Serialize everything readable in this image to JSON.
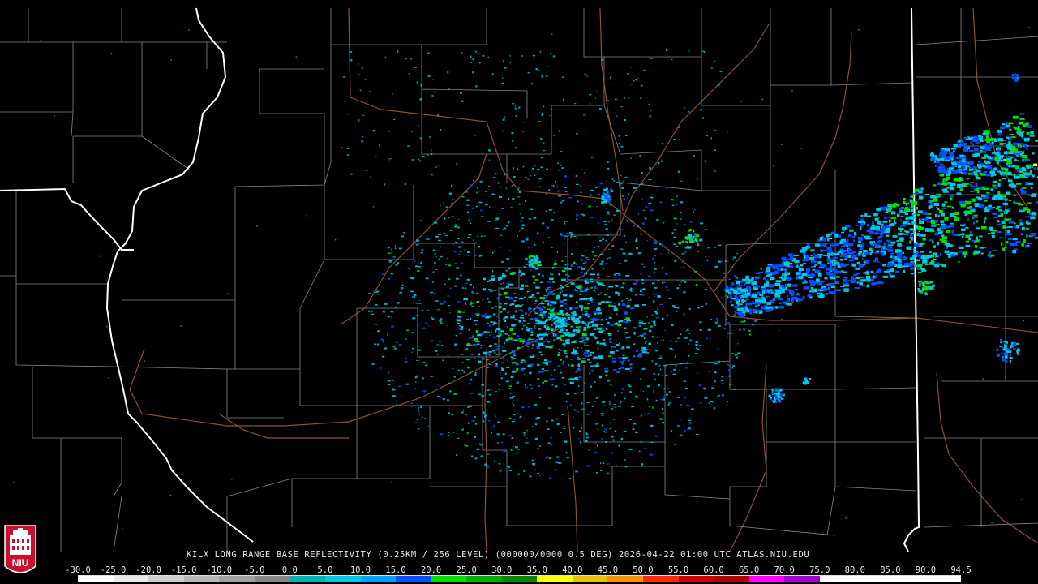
{
  "caption": "KILX LONG RANGE BASE REFLECTIVITY (0.25KM / 256 LEVEL) (000000/0000 0.5 DEG) 2026-04-22 01:00 UTC  ATLAS.NIU.EDU",
  "logo_text": "NIU",
  "legend": {
    "ticks": [
      "-30.0",
      "-25.0",
      "-20.0",
      "-15.0",
      "-10.0",
      "-5.0",
      "0.0",
      "5.0",
      "10.0",
      "15.0",
      "20.0",
      "25.0",
      "30.0",
      "35.0",
      "40.0",
      "45.0",
      "50.0",
      "55.0",
      "60.0",
      "65.0",
      "70.0",
      "75.0",
      "80.0",
      "85.0",
      "90.0",
      "94.5"
    ],
    "colors": [
      "#ffffff",
      "#e8e8e8",
      "#d0d0d0",
      "#b8b8b8",
      "#a0a0a0",
      "#888888",
      "#00b4b4",
      "#00c8e6",
      "#00a0ff",
      "#0050ff",
      "#00e000",
      "#00b000",
      "#008800",
      "#ffff00",
      "#e8c000",
      "#ff9000",
      "#ff2800",
      "#d00000",
      "#b00000",
      "#ff00ff",
      "#a000d0",
      "#ffffff",
      "#ffffff",
      "#ffffff",
      "#ffffff"
    ]
  },
  "colors": {
    "background": "#000000",
    "county_border": "#b4b4b4",
    "state_border": "#ffffff",
    "highway": "#9a5a3a",
    "echo_light_blue": "#00c8e6",
    "echo_blue": "#0050ff",
    "echo_green": "#00e000",
    "echo_yellow": "#ffff00"
  }
}
